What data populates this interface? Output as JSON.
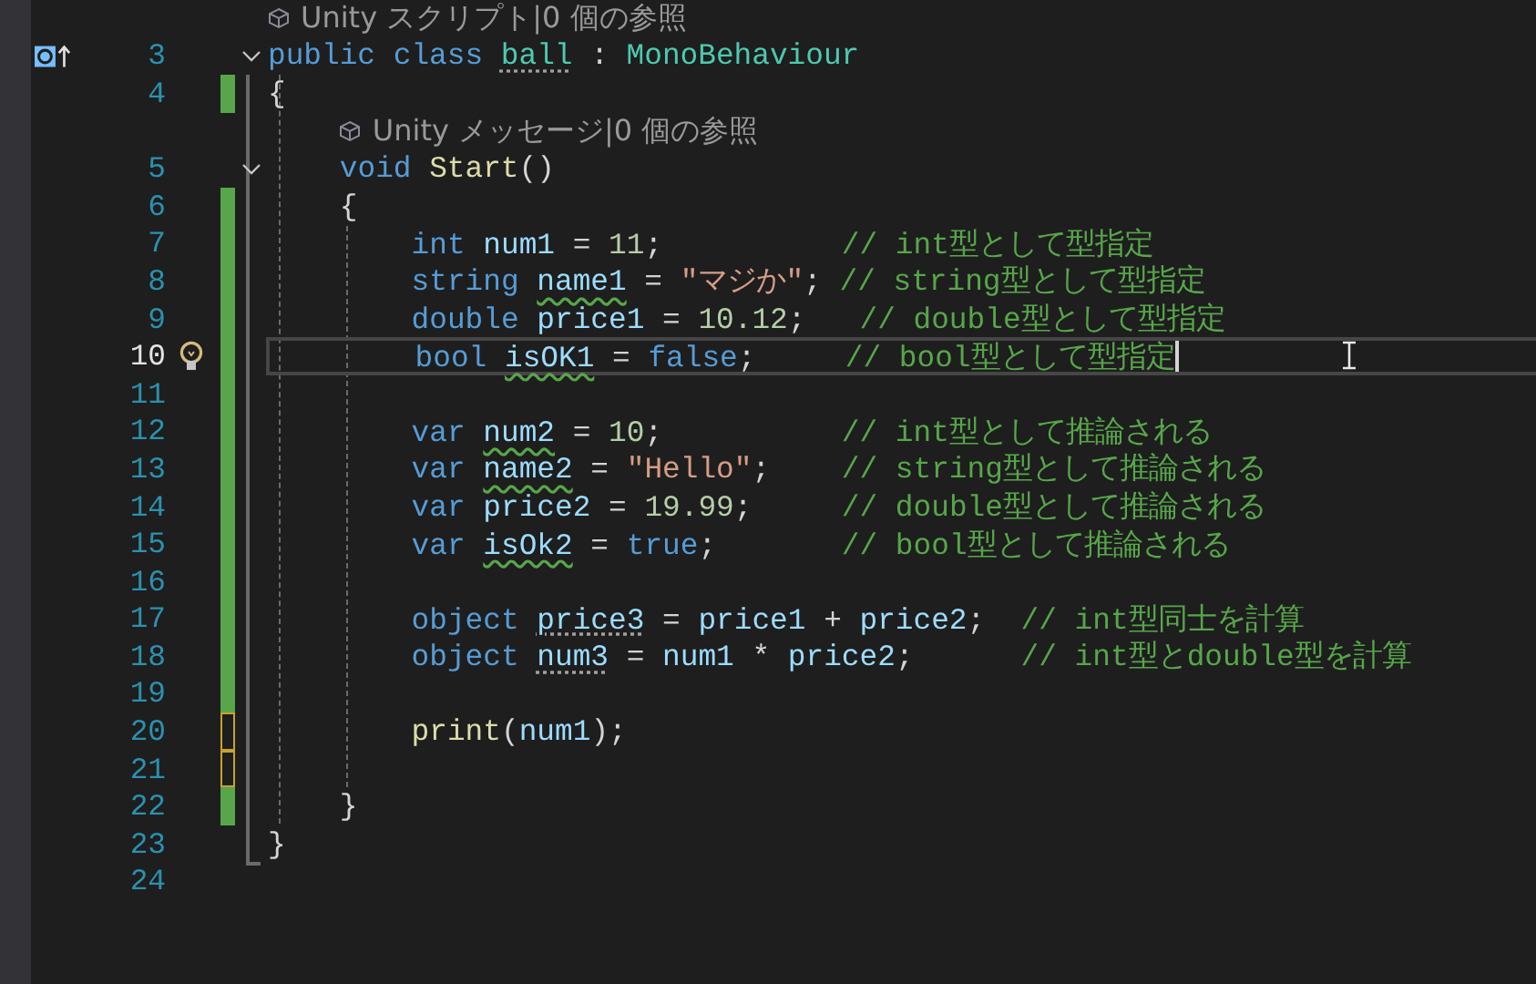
{
  "lines": [
    {
      "kind": "lens",
      "text": "Unity スクリプト|0 個の参照"
    },
    {
      "kind": "code",
      "num": "3",
      "modified": false,
      "fold": true,
      "current": false,
      "glyph": true,
      "bulb": false,
      "tokens": [
        {
          "kind": "kw",
          "text": "public "
        },
        {
          "kind": "kw",
          "text": "class "
        },
        {
          "kind": "type",
          "text": "ball",
          "suggestion": true
        },
        {
          "kind": "pun",
          "text": " : "
        },
        {
          "kind": "type",
          "text": "MonoBehaviour"
        }
      ]
    },
    {
      "kind": "code",
      "num": "4",
      "modified": true,
      "saved": true,
      "fold": false,
      "current": false,
      "glyph": false,
      "bulb": false,
      "tokens": [
        {
          "kind": "pun",
          "text": "{"
        }
      ],
      "children": [
        {
          "kind": "lens",
          "text": "Unity メッセージ|0 個の参照"
        },
        {
          "kind": "code",
          "num": "5",
          "modified": false,
          "fold": true,
          "current": false,
          "glyph": false,
          "bulb": false,
          "tokens": [
            {
              "kind": "kw",
              "text": "void "
            },
            {
              "kind": "fn",
              "text": "Start"
            },
            {
              "kind": "pun",
              "text": "()"
            }
          ]
        },
        {
          "kind": "code",
          "num": "6",
          "modified": true,
          "saved": true,
          "fold": false,
          "current": false,
          "glyph": false,
          "bulb": false,
          "tokens": [
            {
              "kind": "pun",
              "text": "{"
            }
          ],
          "children": [
            {
              "kind": "code",
              "num": "7",
              "modified": true,
              "saved": true,
              "fold": false,
              "current": false,
              "glyph": false,
              "bulb": false,
              "tokens": [
                {
                  "kind": "kw",
                  "text": "int "
                },
                {
                  "kind": "id",
                  "text": "num1"
                },
                {
                  "kind": "pun",
                  "text": " = "
                },
                {
                  "kind": "num",
                  "text": "11"
                },
                {
                  "kind": "pun",
                  "text": ";          "
                },
                {
                  "kind": "cm",
                  "text": "// int型として型指定"
                }
              ]
            },
            {
              "kind": "code",
              "num": "8",
              "modified": true,
              "saved": true,
              "fold": false,
              "current": false,
              "glyph": false,
              "bulb": false,
              "tokens": [
                {
                  "kind": "kw",
                  "text": "string "
                },
                {
                  "kind": "id",
                  "text": "name1",
                  "warning": true
                },
                {
                  "kind": "pun",
                  "text": " = "
                },
                {
                  "kind": "str",
                  "text": "\"マジか\""
                },
                {
                  "kind": "pun",
                  "text": "; "
                },
                {
                  "kind": "cm",
                  "text": "// string型として型指定"
                }
              ]
            },
            {
              "kind": "code",
              "num": "9",
              "modified": true,
              "saved": true,
              "fold": false,
              "current": false,
              "glyph": false,
              "bulb": false,
              "tokens": [
                {
                  "kind": "kw",
                  "text": "double "
                },
                {
                  "kind": "id",
                  "text": "price1"
                },
                {
                  "kind": "pun",
                  "text": " = "
                },
                {
                  "kind": "num",
                  "text": "10.12"
                },
                {
                  "kind": "pun",
                  "text": ";   "
                },
                {
                  "kind": "cm",
                  "text": "// double型として型指定"
                }
              ]
            },
            {
              "kind": "code",
              "num": "10",
              "modified": true,
              "saved": true,
              "fold": false,
              "current": true,
              "glyph": false,
              "bulb": true,
              "tokens": [
                {
                  "kind": "kw",
                  "text": "bool "
                },
                {
                  "kind": "id",
                  "text": "isOK1",
                  "warning": true
                },
                {
                  "kind": "pun",
                  "text": " = "
                },
                {
                  "kind": "kw",
                  "text": "false"
                },
                {
                  "kind": "pun",
                  "text": ";     "
                },
                {
                  "kind": "cm",
                  "text": "// bool型として型指定"
                }
              ]
            },
            {
              "kind": "code",
              "num": "11",
              "modified": true,
              "saved": true,
              "fold": false,
              "current": false,
              "glyph": false,
              "bulb": false
            },
            {
              "kind": "code",
              "num": "12",
              "modified": true,
              "saved": true,
              "fold": false,
              "current": false,
              "glyph": false,
              "bulb": false,
              "tokens": [
                {
                  "kind": "kw",
                  "text": "var "
                },
                {
                  "kind": "id",
                  "text": "num2",
                  "warning": true
                },
                {
                  "kind": "pun",
                  "text": " = "
                },
                {
                  "kind": "num",
                  "text": "10"
                },
                {
                  "kind": "pun",
                  "text": ";          "
                },
                {
                  "kind": "cm",
                  "text": "// int型として推論される"
                }
              ]
            },
            {
              "kind": "code",
              "num": "13",
              "modified": true,
              "saved": true,
              "fold": false,
              "current": false,
              "glyph": false,
              "bulb": false,
              "tokens": [
                {
                  "kind": "kw",
                  "text": "var "
                },
                {
                  "kind": "id",
                  "text": "name2",
                  "warning": true
                },
                {
                  "kind": "pun",
                  "text": " = "
                },
                {
                  "kind": "str",
                  "text": "\"Hello\""
                },
                {
                  "kind": "pun",
                  "text": ";    "
                },
                {
                  "kind": "cm",
                  "text": "// string型として推論される"
                }
              ]
            },
            {
              "kind": "code",
              "num": "14",
              "modified": true,
              "saved": true,
              "fold": false,
              "current": false,
              "glyph": false,
              "bulb": false,
              "tokens": [
                {
                  "kind": "kw",
                  "text": "var "
                },
                {
                  "kind": "id",
                  "text": "price2"
                },
                {
                  "kind": "pun",
                  "text": " = "
                },
                {
                  "kind": "num",
                  "text": "19.99"
                },
                {
                  "kind": "pun",
                  "text": ";     "
                },
                {
                  "kind": "cm",
                  "text": "// double型として推論される"
                }
              ]
            },
            {
              "kind": "code",
              "num": "15",
              "modified": true,
              "saved": true,
              "fold": false,
              "current": false,
              "glyph": false,
              "bulb": false,
              "tokens": [
                {
                  "kind": "kw",
                  "text": "var "
                },
                {
                  "kind": "id",
                  "text": "isOk2",
                  "warning": true
                },
                {
                  "kind": "pun",
                  "text": " = "
                },
                {
                  "kind": "kw",
                  "text": "true"
                },
                {
                  "kind": "pun",
                  "text": ";       "
                },
                {
                  "kind": "cm",
                  "text": "// bool型として推論される"
                }
              ]
            },
            {
              "kind": "code",
              "num": "16",
              "modified": true,
              "saved": true,
              "fold": false,
              "current": false,
              "glyph": false,
              "bulb": false
            },
            {
              "kind": "code",
              "num": "17",
              "modified": true,
              "saved": true,
              "fold": false,
              "current": false,
              "glyph": false,
              "bulb": false,
              "tokens": [
                {
                  "kind": "kw",
                  "text": "object "
                },
                {
                  "kind": "id",
                  "text": "price3",
                  "suggestion": true
                },
                {
                  "kind": "pun",
                  "text": " = "
                },
                {
                  "kind": "id",
                  "text": "price1"
                },
                {
                  "kind": "pun",
                  "text": " + "
                },
                {
                  "kind": "id",
                  "text": "price2"
                },
                {
                  "kind": "pun",
                  "text": ";  "
                },
                {
                  "kind": "cm",
                  "text": "// int型同士を計算"
                }
              ]
            },
            {
              "kind": "code",
              "num": "18",
              "modified": true,
              "saved": true,
              "fold": false,
              "current": false,
              "glyph": false,
              "bulb": false,
              "tokens": [
                {
                  "kind": "kw",
                  "text": "object "
                },
                {
                  "kind": "id",
                  "text": "num3",
                  "suggestion": true
                },
                {
                  "kind": "pun",
                  "text": " = "
                },
                {
                  "kind": "id",
                  "text": "num1"
                },
                {
                  "kind": "pun",
                  "text": " * "
                },
                {
                  "kind": "id",
                  "text": "price2"
                },
                {
                  "kind": "pun",
                  "text": ";      "
                },
                {
                  "kind": "cm",
                  "text": "// int型とdouble型を計算"
                }
              ]
            },
            {
              "kind": "code",
              "num": "19",
              "modified": true,
              "saved": true,
              "fold": false,
              "current": false,
              "glyph": false,
              "bulb": false
            },
            {
              "kind": "code",
              "num": "20",
              "modified": true,
              "saved": false,
              "fold": false,
              "current": false,
              "glyph": false,
              "bulb": false,
              "tokens": [
                {
                  "kind": "fn",
                  "text": "print"
                },
                {
                  "kind": "pun",
                  "text": "("
                },
                {
                  "kind": "id",
                  "text": "num1"
                },
                {
                  "kind": "pun",
                  "text": ");"
                }
              ]
            },
            {
              "kind": "code",
              "num": "21",
              "modified": true,
              "saved": false,
              "fold": false,
              "current": false,
              "glyph": false,
              "bulb": false
            }
          ]
        },
        {
          "kind": "code",
          "num": "22",
          "modified": true,
          "saved": true,
          "fold": false,
          "current": false,
          "glyph": false,
          "bulb": false,
          "tokens": [
            {
              "kind": "pun",
              "text": "}"
            }
          ]
        }
      ]
    },
    {
      "kind": "code",
      "num": "23",
      "modified": false,
      "fold": false,
      "current": false,
      "glyph": false,
      "bulb": false,
      "tokens": [
        {
          "kind": "pun",
          "text": "}"
        }
      ]
    },
    {
      "kind": "code",
      "num": "24",
      "modified": false,
      "fold": false,
      "current": false,
      "glyph": false,
      "bulb": false
    }
  ]
}
